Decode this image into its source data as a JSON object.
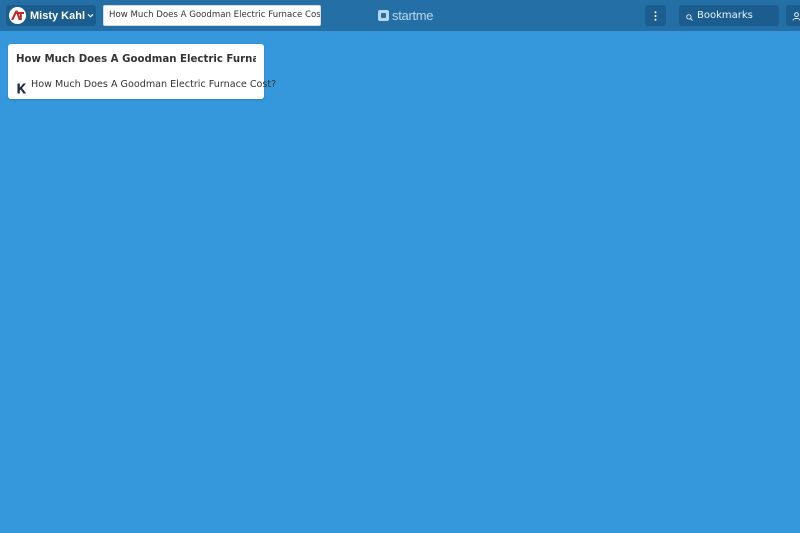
{
  "header": {
    "profile": {
      "name": "Misty Kahl",
      "avatar_icon": "avatar-icon"
    },
    "page_title": "How Much Does A Goodman Electric Furnace Cost?",
    "logo": {
      "text": "startme"
    },
    "menu_icon": "more-vertical-icon",
    "search": {
      "placeholder": "Bookmarks",
      "icon": "search-icon"
    },
    "user_icon": "user-icon"
  },
  "widgets": [
    {
      "title": "How Much Does A Goodman Electric Furnace ...",
      "bookmarks": [
        {
          "label": "How Much Does A Goodman Electric Furnace Cost?",
          "icon": "k-favicon-icon"
        }
      ]
    }
  ],
  "colors": {
    "background": "#3598dc",
    "topbar": "#246fa5",
    "button": "#1b5d8f",
    "card": "#ffffff"
  }
}
